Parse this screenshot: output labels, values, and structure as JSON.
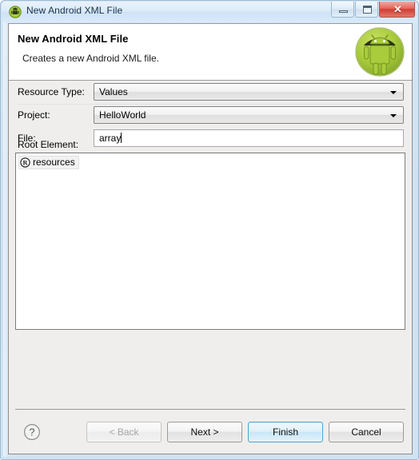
{
  "window": {
    "title": "New Android XML File",
    "icon": "android-green-circle-icon",
    "controls": {
      "minimize": "minimize-button",
      "maximize": "maximize-button",
      "close_label": "✕"
    }
  },
  "header": {
    "title": "New Android XML File",
    "subtitle": "Creates a new Android XML file.",
    "logo": "android-robot-logo"
  },
  "form": {
    "resource_type": {
      "label": "Resource Type:",
      "value": "Values"
    },
    "project": {
      "label": "Project:",
      "value": "HelloWorld"
    },
    "file": {
      "label": "File:",
      "value": "array",
      "placeholder": ""
    }
  },
  "root_element": {
    "label": "Root Element:",
    "items": [
      {
        "icon": "circled-r-icon",
        "label": "resources"
      }
    ]
  },
  "footer": {
    "help": "?",
    "buttons": [
      {
        "label": "< Back",
        "state": "disabled"
      },
      {
        "label": "Next >",
        "state": "normal"
      },
      {
        "label": "Finish",
        "state": "default"
      },
      {
        "label": "Cancel",
        "state": "normal"
      }
    ]
  },
  "colors": {
    "title_bar": "#dcebf8",
    "dialog_bg": "#efeeed",
    "android_green": "#a4c639",
    "default_button_border": "#4ba4cd",
    "close_button": "#cf3f33"
  }
}
